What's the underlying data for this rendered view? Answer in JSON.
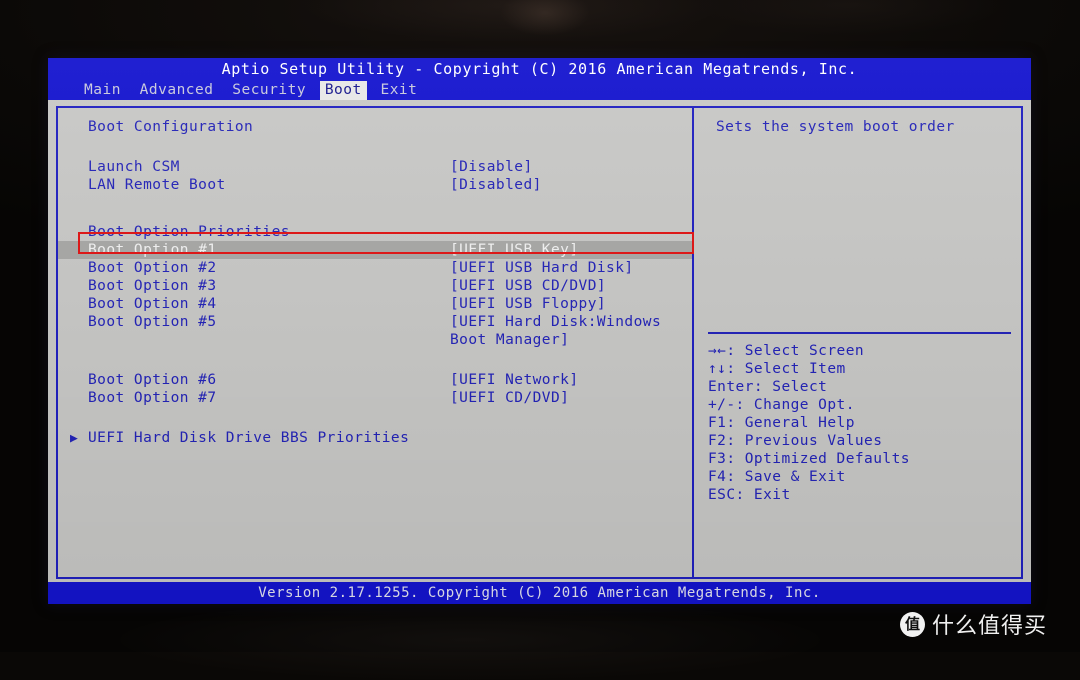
{
  "window": {
    "title": "Aptio Setup Utility - Copyright (C) 2016 American Megatrends, Inc.",
    "footer": "Version 2.17.1255. Copyright (C) 2016 American Megatrends, Inc."
  },
  "menu": {
    "items": [
      {
        "label": "Main",
        "active": false
      },
      {
        "label": "Advanced",
        "active": false
      },
      {
        "label": "Security",
        "active": false
      },
      {
        "label": "Boot",
        "active": true
      },
      {
        "label": "Exit",
        "active": false
      }
    ]
  },
  "main": {
    "boot_configuration_heading": "Boot Configuration",
    "settings": [
      {
        "label": "Launch CSM",
        "value": "[Disable]"
      },
      {
        "label": "LAN Remote Boot",
        "value": "[Disabled]"
      }
    ],
    "boot_priorities_heading": "Boot Option Priorities",
    "boot_options": [
      {
        "label": "Boot Option #1",
        "value": "[UEFI USB Key]",
        "value_line2": "",
        "selected": true
      },
      {
        "label": "Boot Option #2",
        "value": "[UEFI USB Hard Disk]",
        "value_line2": "",
        "selected": false
      },
      {
        "label": "Boot Option #3",
        "value": "[UEFI USB CD/DVD]",
        "value_line2": "",
        "selected": false
      },
      {
        "label": "Boot Option #4",
        "value": "[UEFI USB Floppy]",
        "value_line2": "",
        "selected": false
      },
      {
        "label": "Boot Option #5",
        "value": "[UEFI Hard Disk:Windows",
        "value_line2": "Boot Manager]",
        "selected": false
      },
      {
        "label": "Boot Option #6",
        "value": "[UEFI Network]",
        "value_line2": "",
        "selected": false
      },
      {
        "label": "Boot Option #7",
        "value": "[UEFI CD/DVD]",
        "value_line2": "",
        "selected": false
      }
    ],
    "submenu": {
      "marker": "▶",
      "label": "UEFI Hard Disk Drive BBS Priorities"
    }
  },
  "help": {
    "description": "Sets the system boot order",
    "keys": [
      "→←: Select Screen",
      "↑↓: Select Item",
      "Enter: Select",
      "+/-: Change Opt.",
      "F1: General Help",
      "F2: Previous Values",
      "F3: Optimized Defaults",
      "F4: Save & Exit",
      "ESC: Exit"
    ]
  },
  "watermark": {
    "logo_glyph": "值",
    "text": "什么值得买"
  },
  "colors": {
    "bios_blue": "#1414cf",
    "text_blue": "#2424b8",
    "panel_bg": "#c8c8c6",
    "selection_bg": "#a8a8a6",
    "annotation_red": "#e01414"
  }
}
